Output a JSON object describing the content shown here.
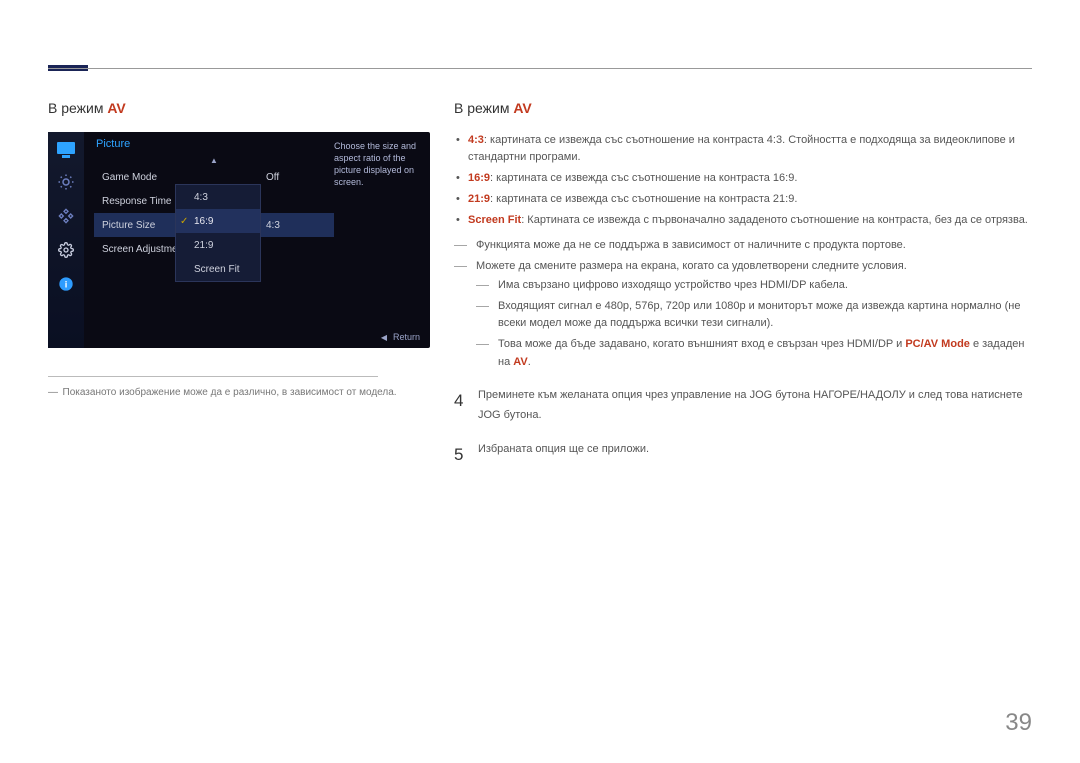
{
  "page_number": "39",
  "left": {
    "heading_prefix": "В режим ",
    "heading_em": "AV",
    "osd": {
      "title": "Picture",
      "rows": [
        {
          "label": "Game Mode",
          "value": "Off"
        },
        {
          "label": "Response Time",
          "value": ""
        },
        {
          "label": "Picture Size",
          "value": "4:3",
          "selected": true
        },
        {
          "label": "Screen Adjustment",
          "value": ""
        }
      ],
      "popup": [
        "4:3",
        "16:9",
        "21:9",
        "Screen Fit"
      ],
      "popup_selected_index": 1,
      "help_lines": "Choose the size and aspect ratio of the picture displayed on screen.",
      "return_label": "Return"
    },
    "footnote_dash": "―",
    "footnote": "Показаното изображение може да е различно, в зависимост от модела."
  },
  "right": {
    "heading_prefix": "В режим ",
    "heading_em": "AV",
    "bullets": [
      {
        "em": "4:3",
        "text": ": картината се извежда със съотношение на контраста 4:3. Стойността е подходяща за видеоклипове и стандартни програми."
      },
      {
        "em": "16:9",
        "text": ": картината се извежда със съотношение на контраста 16:9."
      },
      {
        "em": "21:9",
        "text": ": картината се извежда със съотношение на контраста 21:9."
      },
      {
        "em": "Screen Fit",
        "text": ": Картината се извежда с първоначално зададеното съотношение на контраста, без да се отрязва."
      }
    ],
    "dashes": [
      "Функцията може да не се поддържа в зависимост от наличните с продукта портове.",
      "Можете да смените размера на екрана, когато са удовлетворени следните условия."
    ],
    "nested": [
      "Има свързано цифрово изходящо устройство чрез HDMI/DP кабела.",
      "Входящият сигнал е 480p, 576p, 720p или 1080p и мониторът може да извежда картина нормално (не всеки модел може да поддържа всички тези сигнали).",
      {
        "pre": "Това може да бъде задавано, когато външният вход е свързан чрез HDMI/DP и ",
        "em": "PC/AV Mode",
        "mid": " е зададен на ",
        "em2": "AV",
        "post": "."
      }
    ],
    "steps": [
      {
        "num": "4",
        "text": "Преминете към желаната опция чрез управление на JOG бутона НАГОРЕ/НАДОЛУ и след това натиснете JOG бутона."
      },
      {
        "num": "5",
        "text": "Избраната опция ще се приложи."
      }
    ]
  }
}
